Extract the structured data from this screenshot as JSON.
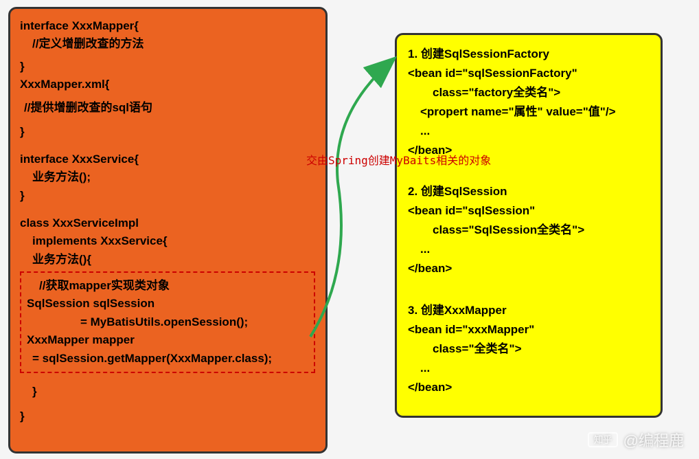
{
  "left": {
    "block1_line1": "interface XxxMapper{",
    "block1_line2": "//定义增删改查的方法",
    "block1_close": "}",
    "block2_line1": "XxxMapper.xml{",
    "block2_line2": "//提供增删改查的sql语句",
    "block2_close": "}",
    "block3_line1": "interface XxxService{",
    "block3_line2": "业务方法();",
    "block3_close": "}",
    "block4_line1": "class XxxServiceImpl",
    "block4_line2": "implements XxxService{",
    "block4_line3": "业务方法(){",
    "dashed_line1": "//获取mapper实现类对象",
    "dashed_line2": "SqlSession sqlSession",
    "dashed_line3": "= MyBatisUtils.openSession();",
    "dashed_line4": "XxxMapper mapper",
    "dashed_line5": "= sqlSession.getMapper(XxxMapper.class);",
    "block4_close1": "}",
    "block4_close2": "}"
  },
  "arrow_label": "交由Spring创建MyBaits相关的对象",
  "right": {
    "s1_title": "1. 创建SqlSessionFactory",
    "s1_l1": "<bean id=\"sqlSessionFactory\"",
    "s1_l2": "class=\"factory全类名\">",
    "s1_l3": "<propert name=\"属性\" value=\"值\"/>",
    "s1_l4": "...",
    "s1_close": "</bean>",
    "s2_title": "2. 创建SqlSession",
    "s2_l1": "<bean id=\"sqlSession\"",
    "s2_l2": "class=\"SqlSession全类名\">",
    "s2_l3": "...",
    "s2_close": "</bean>",
    "s3_title": "3. 创建XxxMapper",
    "s3_l1": "<bean id=\"xxxMapper\"",
    "s3_l2": "class=\"全类名\">",
    "s3_l3": "...",
    "s3_close": "</bean>"
  },
  "watermark": "@编程鹿",
  "zhihu": "知乎"
}
